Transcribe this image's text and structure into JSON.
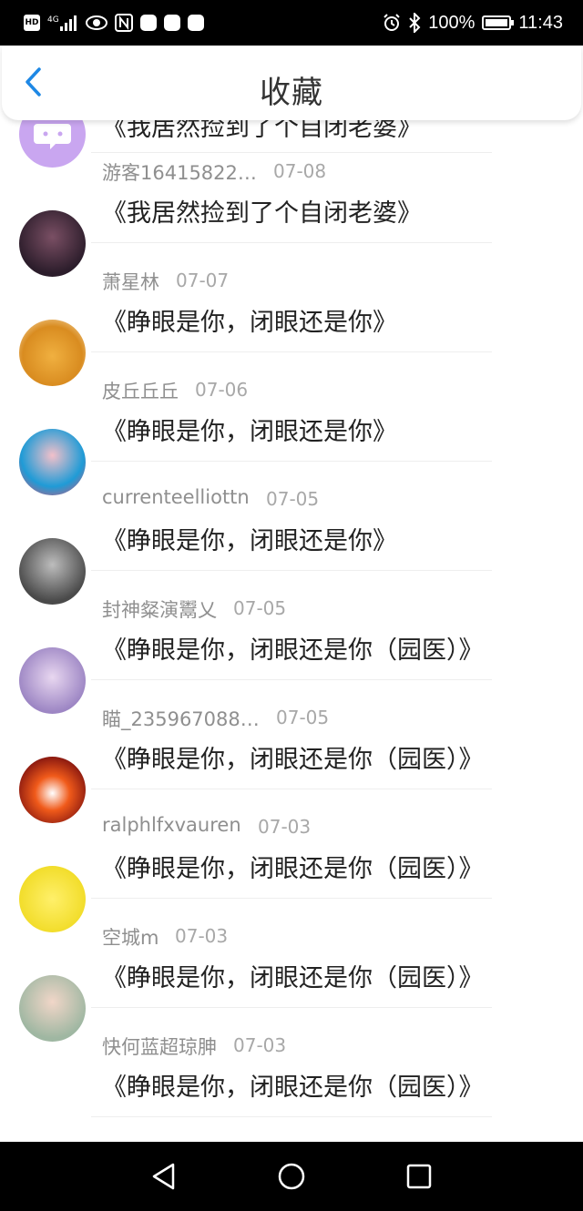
{
  "status_bar": {
    "hd": "HD",
    "network": "4G",
    "battery_percent": "100%",
    "time": "11:43",
    "icons": [
      "hd-icon",
      "signal-icon",
      "eye-icon",
      "n-icon",
      "app-icon",
      "huawei-icon",
      "hms-icon",
      "alarm-icon",
      "bluetooth-icon",
      "battery-charging-icon"
    ]
  },
  "header": {
    "title": "收藏",
    "back_icon": "chevron-left-icon"
  },
  "colors": {
    "accent": "#1e88e5",
    "name_text": "#8f8f8f",
    "date_text": "#a8a8a8",
    "title_text": "#222222"
  },
  "partial_item": {
    "title": "《我居然捡到了个自闭老婆》"
  },
  "items": [
    {
      "name": "游客16415822…",
      "date": "07-08",
      "title": "《我居然捡到了个自闭老婆》",
      "avatar": "purple-chat-avatar"
    },
    {
      "name": "萧星林",
      "date": "07-07",
      "title": "《睁眼是你，闭眼还是你》",
      "avatar": "dark-anime-avatar"
    },
    {
      "name": "皮丘丘丘",
      "date": "07-06",
      "title": "《睁眼是你，闭眼还是你》",
      "avatar": "shiba-avatar"
    },
    {
      "name": "currenteelliottn",
      "date": "07-05",
      "title": "《睁眼是你，闭眼还是你》",
      "avatar": "cartoon-girl-avatar"
    },
    {
      "name": "封神粲演鬻乂",
      "date": "07-05",
      "title": "《睁眼是你，闭眼还是你（园医）》",
      "avatar": "bw-girl-avatar"
    },
    {
      "name": "瞄_235967088…",
      "date": "07-05",
      "title": "《睁眼是你，闭眼还是你（园医）》",
      "avatar": "anime-couple-avatar"
    },
    {
      "name": "ralphlfxvauren",
      "date": "07-03",
      "title": "《睁眼是你，闭眼还是你（园医）》",
      "avatar": "fire-soccer-avatar"
    },
    {
      "name": "空城m",
      "date": "07-03",
      "title": "《睁眼是你，闭眼还是你（园医）》",
      "avatar": "spongebob-avatar"
    },
    {
      "name": "快何蓝超琼胂",
      "date": "07-03",
      "title": "《睁眼是你，闭眼还是你（园医）》",
      "avatar": "woman-photo-avatar"
    }
  ],
  "nav": {
    "icons": [
      "back-triangle-icon",
      "home-circle-icon",
      "recents-square-icon"
    ]
  }
}
